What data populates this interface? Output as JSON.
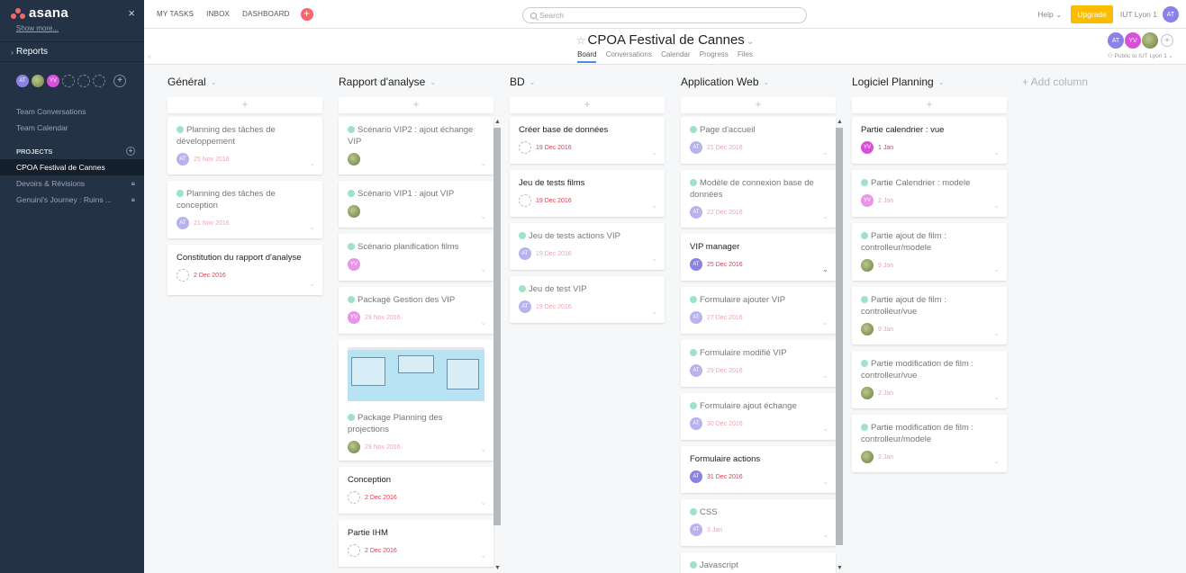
{
  "sidebar": {
    "logo": "asana",
    "close": "×",
    "show_more": "Show more...",
    "reports": "Reports",
    "members": [
      {
        "initials": "AT",
        "color": "#8a82e6"
      },
      {
        "initials": "",
        "color": "#7fa34a"
      },
      {
        "initials": "YV",
        "color": "#d94fd9"
      }
    ],
    "team_conversations": "Team Conversations",
    "team_calendar": "Team Calendar",
    "projects_label": "PROJECTS",
    "projects": [
      {
        "name": "CPOA Festival de Cannes",
        "active": true,
        "locked": false
      },
      {
        "name": "Devoirs & Révisions",
        "active": false,
        "locked": true
      },
      {
        "name": "Genuini's Journey : Ruins ...",
        "active": false,
        "locked": true
      }
    ]
  },
  "topbar": {
    "nav": [
      "MY TASKS",
      "INBOX",
      "DASHBOARD"
    ],
    "quick_add": "+",
    "search_placeholder": "Search",
    "help": "Help",
    "upgrade": "Upgrade",
    "org": "IUT Lyon 1",
    "user_initials": "AT"
  },
  "project": {
    "title": "CPOA Festival de Cannes",
    "tabs": [
      "Board",
      "Conversations",
      "Calendar",
      "Progress",
      "Files"
    ],
    "active_tab": "Board",
    "members": [
      {
        "initials": "AT",
        "color": "#8a82e6"
      },
      {
        "initials": "YV",
        "color": "#d94fd9"
      },
      {
        "initials": "",
        "color": "#7fa34a"
      }
    ],
    "privacy": "Public to IUT Lyon 1",
    "add_column": "+ Add column"
  },
  "columns": [
    {
      "name": "Général",
      "cards": [
        {
          "title": "Planning des tâches de développement",
          "done": true,
          "assignee": "AT",
          "due": "25 Nov 2016",
          "faded": true
        },
        {
          "title": "Planning des tâches de conception",
          "done": true,
          "assignee": "AT",
          "due": "21 Nov 2016",
          "faded": true
        },
        {
          "title": "Constitution du rapport d'analyse",
          "done": false,
          "assignee": "",
          "due": "2 Dec 2016",
          "faded": false
        }
      ]
    },
    {
      "name": "Rapport d'analyse",
      "cards": [
        {
          "title": "Scénario VIP2 : ajout échange VIP",
          "done": true,
          "assignee": "photo",
          "due": "",
          "faded": true
        },
        {
          "title": "Scénario VIP1 : ajout VIP",
          "done": true,
          "assignee": "photo",
          "due": "",
          "faded": true
        },
        {
          "title": "Scénario planification films",
          "done": true,
          "assignee": "YV",
          "due": "",
          "faded": true
        },
        {
          "title": "Package Gestion des VIP",
          "done": true,
          "assignee": "YV",
          "due": "29 Nov 2016",
          "faded": true
        },
        {
          "title": "Package Planning des projections",
          "done": true,
          "assignee": "photo",
          "due": "29 Nov 2016",
          "faded": true
        },
        {
          "title": "Conception",
          "done": false,
          "assignee": "",
          "due": "2 Dec 2016",
          "faded": false
        },
        {
          "title": "Partie IHM",
          "done": false,
          "assignee": "",
          "due": "2 Dec 2016",
          "faded": false
        }
      ]
    },
    {
      "name": "BD",
      "cards": [
        {
          "title": "Créer base de données",
          "done": false,
          "assignee": "",
          "due": "19 Dec 2016",
          "faded": false
        },
        {
          "title": "Jeu de tests films",
          "done": false,
          "assignee": "",
          "due": "19 Dec 2016",
          "faded": false
        },
        {
          "title": "Jeu de tests actions VIP",
          "done": true,
          "assignee": "AT",
          "due": "19 Dec 2016",
          "faded": true
        },
        {
          "title": "Jeu de test VIP",
          "done": true,
          "assignee": "AT",
          "due": "19 Dec 2016",
          "faded": true
        }
      ]
    },
    {
      "name": "Application Web",
      "cards": [
        {
          "title": "Page d'accueil",
          "done": true,
          "assignee": "AT",
          "due": "21 Dec 2016",
          "faded": true
        },
        {
          "title": "Modèle de connexion base de données",
          "done": true,
          "assignee": "AT",
          "due": "22 Dec 2016",
          "faded": true
        },
        {
          "title": "VIP manager",
          "done": false,
          "assignee": "AT",
          "due": "25 Dec 2016",
          "faded": false
        },
        {
          "title": "Formulaire ajouter VIP",
          "done": true,
          "assignee": "AT",
          "due": "27 Dec 2016",
          "faded": true
        },
        {
          "title": "Formulaire modifié VIP",
          "done": true,
          "assignee": "AT",
          "due": "29 Dec 2016",
          "faded": true
        },
        {
          "title": "Formulaire ajout échange",
          "done": true,
          "assignee": "AT",
          "due": "30 Dec 2016",
          "faded": true
        },
        {
          "title": "Formulaire actions",
          "done": false,
          "assignee": "AT",
          "due": "31 Dec 2016",
          "faded": false
        },
        {
          "title": "CSS",
          "done": true,
          "assignee": "AT",
          "due": "3 Jan",
          "faded": true
        },
        {
          "title": "Javascript",
          "done": true,
          "assignee": "",
          "due": "",
          "faded": true
        }
      ]
    },
    {
      "name": "Logiciel Planning",
      "cards": [
        {
          "title": "Partie calendrier : vue",
          "done": false,
          "assignee": "YV",
          "due": "1 Jan",
          "faded": false
        },
        {
          "title": "Partie Calendrier : modele",
          "done": true,
          "assignee": "YV",
          "due": "2 Jan",
          "faded": true
        },
        {
          "title": "Partie ajout de film : controlleur/modele",
          "done": true,
          "assignee": "photo",
          "due": "9 Jan",
          "faded": true
        },
        {
          "title": "Partie ajout de film : controlleur/vue",
          "done": true,
          "assignee": "photo",
          "due": "9 Jan",
          "faded": true
        },
        {
          "title": "Partie modification de film : controlleur/vue",
          "done": true,
          "assignee": "photo",
          "due": "2 Jan",
          "faded": true
        },
        {
          "title": "Partie modification de film : controlleur/modele",
          "done": true,
          "assignee": "photo",
          "due": "2 Jan",
          "faded": true
        }
      ]
    }
  ],
  "colors": {
    "at": "#8a82e6",
    "yv": "#d94fd9",
    "due": "#e8384f",
    "upgrade": "#fcbd01",
    "sidebar": "#243246"
  }
}
